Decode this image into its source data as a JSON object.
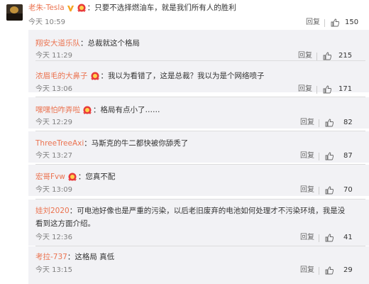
{
  "top": {
    "username": "老朱-Tesla",
    "text": "：只要不选择燃油车，就是我们所有人的胜利",
    "time": "今天 10:59",
    "reply": "回复",
    "likes": "150"
  },
  "replies": [
    {
      "username": "翔安大道乐队",
      "text": "：总裁就这个格局",
      "time": "今天 11:29",
      "reply": "回复",
      "likes": "215",
      "medal": false
    },
    {
      "username": "浓眉毛的大鼻子",
      "text": "：我以为看错了，这是总裁？我以为是个网络喷子",
      "time": "今天 13:06",
      "reply": "回复",
      "likes": "171",
      "medal": true
    },
    {
      "username": "嘿嘿怕咋弄啦",
      "text": "：格局有点小了……",
      "time": "今天 12:29",
      "reply": "回复",
      "likes": "82",
      "medal": true
    },
    {
      "username": "ThreeTreeAxi",
      "text": "：马斯克的牛二都快被你舔秃了",
      "time": "今天 13:27",
      "reply": "回复",
      "likes": "87",
      "medal": false
    },
    {
      "username": "宏哥Fvw",
      "text": "：您真不配",
      "time": "今天 13:09",
      "reply": "回复",
      "likes": "70",
      "medal": true
    },
    {
      "username": "娃刘2020",
      "text": "：可电池好像也是严重的污染，以后老旧废弃的电池如何处理才不污染环境，我是没",
      "text2": "看到这方面介绍。",
      "time": "今天 12:36",
      "reply": "回复",
      "likes": "41",
      "medal": false
    },
    {
      "username": "考拉-737",
      "text": "：这格局 真低",
      "time": "今天 13:15",
      "reply": "回复",
      "likes": "29",
      "medal": false
    }
  ],
  "colors": {
    "username": "#eb7350",
    "reply_bg": "#f2f2f5",
    "badge": "#f5a623",
    "medal": "#e83a3a"
  }
}
